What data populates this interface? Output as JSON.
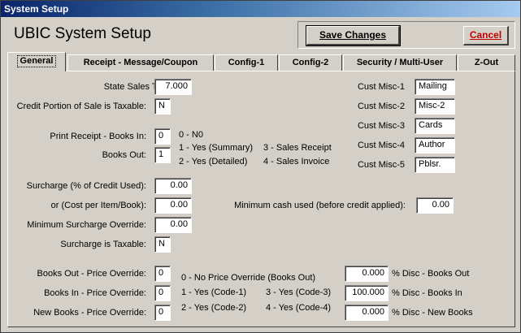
{
  "window": {
    "title": "System Setup"
  },
  "header": {
    "app_title": "UBIC System Setup",
    "save_label": "Save Changes",
    "cancel_label": "Cancel"
  },
  "tabs": [
    {
      "label": "General",
      "active": true
    },
    {
      "label": "Receipt - Message/Coupon"
    },
    {
      "label": "Config-1"
    },
    {
      "label": "Config-2"
    },
    {
      "label": "Security / Multi-User"
    },
    {
      "label": "Z-Out"
    }
  ],
  "general": {
    "state_sales_tax": {
      "label": "State Sales Tax:",
      "value": "7.000"
    },
    "credit_taxable": {
      "label": "Credit Portion of Sale is Taxable:",
      "value": "N"
    },
    "print_books_in": {
      "label": "Print Receipt - Books In:",
      "value": "0"
    },
    "books_out": {
      "label": "Books Out:",
      "value": "1"
    },
    "print_options": {
      "opt0": "0 - N0",
      "opt1": "1 - Yes (Summary)",
      "opt2": "2 - Yes (Detailed)",
      "opt3": "3 - Sales Receipt",
      "opt4": "4 - Sales Invoice"
    },
    "surcharge_pct": {
      "label": "Surcharge (% of Credit Used):",
      "value": "0.00"
    },
    "surcharge_cost": {
      "label": "or (Cost per Item/Book):",
      "value": "0.00"
    },
    "min_surcharge": {
      "label": "Minimum Surcharge Override:",
      "value": "0.00"
    },
    "surcharge_taxable": {
      "label": "Surcharge is Taxable:",
      "value": "N"
    },
    "min_cash": {
      "label": "Minimum cash used (before credit applied):",
      "value": "0.00"
    },
    "cust_misc": [
      {
        "label": "Cust Misc-1",
        "value": "Mailing"
      },
      {
        "label": "Cust Misc-2",
        "value": "Misc-2"
      },
      {
        "label": "Cust Misc-3",
        "value": "Cards"
      },
      {
        "label": "Cust Misc-4",
        "value": "Author"
      },
      {
        "label": "Cust Misc-5",
        "value": "Pblsr."
      }
    ],
    "price_override": {
      "books_out": {
        "label": "Books Out - Price Override:",
        "value": "0"
      },
      "books_in": {
        "label": "Books In - Price Override:",
        "value": "0"
      },
      "new_books": {
        "label": "New Books - Price Override:",
        "value": "0"
      },
      "opt0": "0 - No Price Override (Books Out)",
      "opt1": "1 - Yes (Code-1)",
      "opt2": "2 - Yes (Code-2)",
      "opt3": "3 - Yes (Code-3)",
      "opt4": "4 - Yes (Code-4)"
    },
    "discounts": {
      "books_out": {
        "label": "% Disc - Books Out",
        "value": "0.000"
      },
      "books_in": {
        "label": "% Disc - Books In",
        "value": "100.000"
      },
      "new_books": {
        "label": "% Disc - New Books",
        "value": "0.000"
      }
    }
  }
}
